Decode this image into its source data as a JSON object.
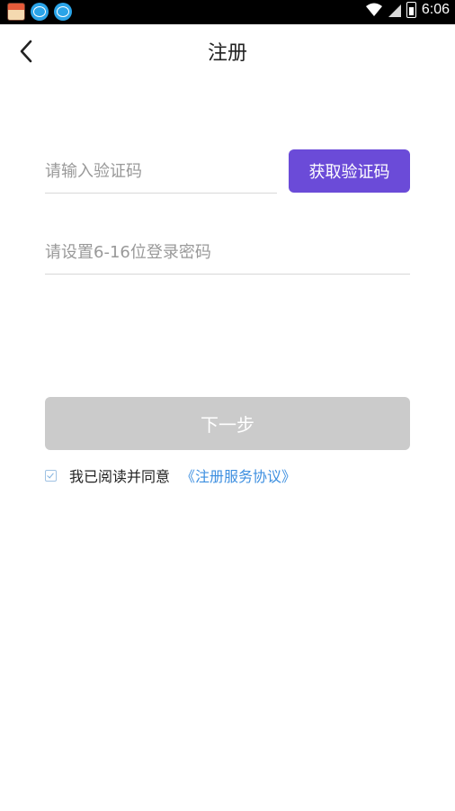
{
  "status_bar": {
    "time": "6:06",
    "icons": [
      "calendar-icon",
      "chat-bubble-icon",
      "chat-bubble-icon",
      "wifi-icon",
      "signal-icon",
      "battery-icon"
    ]
  },
  "header": {
    "title": "注册"
  },
  "form": {
    "code_placeholder": "请输入验证码",
    "get_code_label": "获取验证码",
    "password_placeholder": "请设置6-16位登录密码",
    "next_label": "下一步"
  },
  "agreement": {
    "checked": true,
    "text": "我已阅读并同意",
    "link": "《注册服务协议》"
  },
  "colors": {
    "accent": "#6b4bd8",
    "disabled_button": "#cbcbcb",
    "link": "#3d8fe0"
  }
}
